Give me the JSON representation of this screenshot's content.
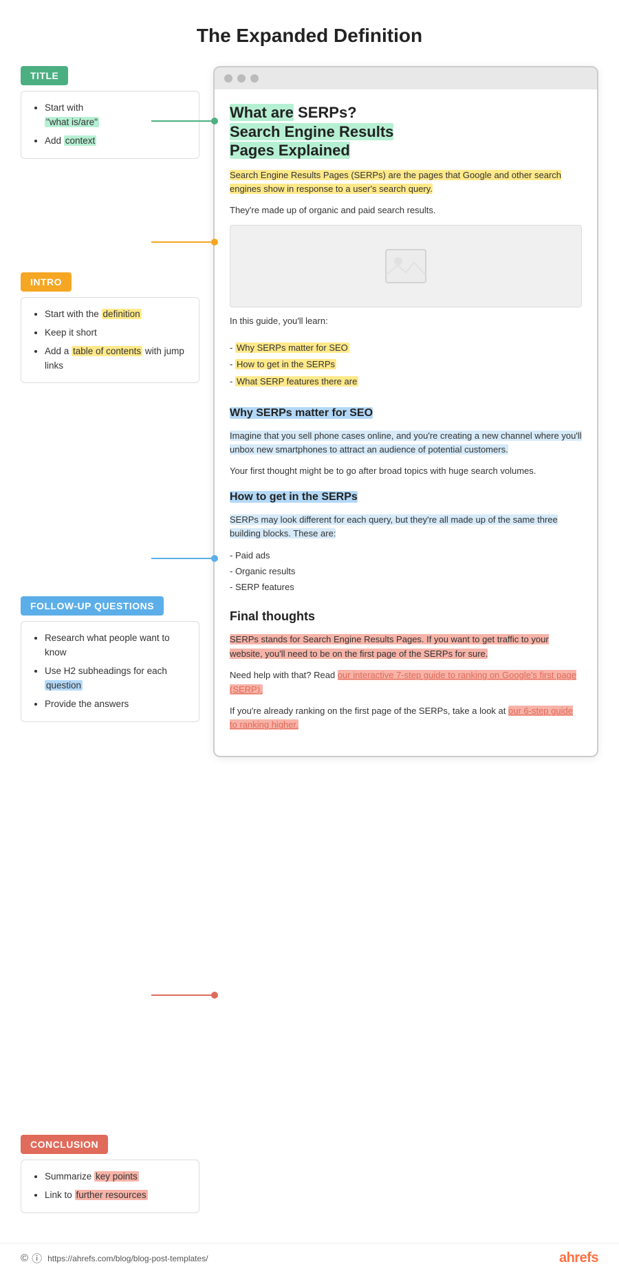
{
  "page": {
    "title": "The Expanded Definition"
  },
  "sidebar": {
    "title_label": "TITLE",
    "title_items": [
      "Start with",
      "\"what is/are\"",
      "Add context"
    ],
    "intro_label": "INTRO",
    "intro_items": [
      "Start with the",
      "definition",
      "Keep it short",
      "Add a",
      "table of contents",
      " with jump links"
    ],
    "followup_label": "FOLLOW-UP QUESTIONS",
    "followup_items": [
      "Research what people want to know",
      "Use H2 subheadings for each",
      "question",
      "Provide the answers"
    ],
    "conclusion_label": "CONCLUSION",
    "conclusion_items": [
      "Summarize",
      "key points",
      "Link to further",
      "resources"
    ]
  },
  "article": {
    "title_part1": "What are",
    "title_part2": " SERPs?",
    "title_line2": "Search Engine Results",
    "title_line3": "Pages Explained",
    "intro_highlighted": "Search Engine Results Pages (SERPs) are the pages that Google and other search engines show in response to a user's search query.",
    "intro_para": "They're made up of organic and paid search results.",
    "guide_intro": "In this guide, you'll learn:",
    "toc": [
      "- Why SERPs matter for SEO",
      "- How to get in the SERPs",
      "- What SERP features there are"
    ],
    "h2_1": "Why SERPs matter for SEO",
    "h2_1_para1_highlighted": "Imagine that you sell phone cases online, and you're creating a new channel where you'll unbox new smartphones to attract an audience of potential customers.",
    "h2_1_para2": "Your first thought might be to go after broad topics with huge search volumes.",
    "h2_2": "How to get in the SERPs",
    "h2_2_para_highlighted": "SERPs may look different for each query, but they're all made up of the same three building blocks. These are:",
    "h2_2_list": [
      "- Paid ads",
      "- Organic results",
      "- SERP features"
    ],
    "final_title": "Final thoughts",
    "conclusion_para1_highlighted": "SERPs stands for Search Engine Results Pages. If you want to get traffic to your website, you'll need to be on the first page of the SERPs for sure.",
    "conclusion_para2_pre": "Need help with that? Read ",
    "conclusion_para2_link": "our interactive 7-step guide to ranking on Google's first page (SERP).",
    "conclusion_para3_pre": "If you're already ranking on the first page of the SERPs, take a look at ",
    "conclusion_para3_link": "our 6-step guide to ranking higher."
  },
  "footer": {
    "url": "https://ahrefs.com/blog/blog-post-templates/",
    "brand": "ahrefs"
  }
}
